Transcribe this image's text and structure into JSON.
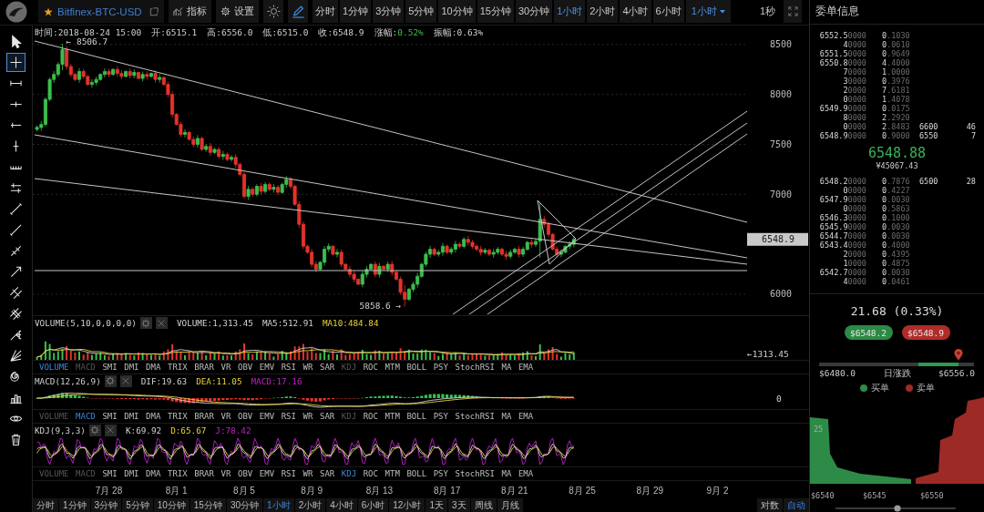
{
  "toolbar": {
    "symbol": "Bitfinex-BTC-USD",
    "buttons": [
      {
        "label": "指标",
        "kind": "indicators"
      },
      {
        "label": "设置",
        "kind": "settings"
      }
    ],
    "draw_mode": true,
    "periods": [
      {
        "label": "分时",
        "selected": false
      },
      {
        "label": "1分钟",
        "selected": false
      },
      {
        "label": "3分钟",
        "selected": false
      },
      {
        "label": "5分钟",
        "selected": false
      },
      {
        "label": "10分钟",
        "selected": false
      },
      {
        "label": "15分钟",
        "selected": false
      },
      {
        "label": "30分钟",
        "selected": false
      },
      {
        "label": "1小时",
        "selected": true
      },
      {
        "label": "2小时",
        "selected": false
      },
      {
        "label": "4小时",
        "selected": false
      },
      {
        "label": "6小时",
        "selected": false
      }
    ],
    "period_menu": {
      "label": "1小时",
      "selected": true
    },
    "refresh": "1秒"
  },
  "drawing_tools": [
    {
      "selected": false
    },
    {
      "selected": true
    },
    {
      "selected": false
    },
    {
      "selected": false
    },
    {
      "selected": false
    },
    {
      "selected": false
    },
    {
      "selected": false
    },
    {
      "selected": false
    },
    {
      "selected": false
    },
    {
      "selected": false
    },
    {
      "selected": false
    },
    {
      "selected": false
    },
    {
      "selected": false
    },
    {
      "selected": false
    },
    {
      "selected": false
    },
    {
      "selected": false
    },
    {
      "selected": false
    },
    {
      "selected": false
    },
    {
      "selected": false
    },
    {
      "selected": false
    }
  ],
  "price_chart": {
    "info": [
      {
        "label": "时间:",
        "value": "2018-08-24 15:00",
        "up": false
      },
      {
        "label": "开:",
        "value": "6515.1",
        "up": false
      },
      {
        "label": "高:",
        "value": "6556.0",
        "up": false
      },
      {
        "label": "低:",
        "value": "6515.0",
        "up": false
      },
      {
        "label": "收:",
        "value": "6548.9",
        "up": false
      },
      {
        "label": "涨幅:",
        "value": "0.52%",
        "up": true
      },
      {
        "label": "振幅:",
        "value": "0.63%",
        "up": false
      }
    ],
    "y_axis_labels": [
      "8500",
      "8000",
      "7500",
      "7000",
      "6000"
    ],
    "high_label": "← 8506.7",
    "low_label": "5858.6 →",
    "last_price": "6548.9"
  },
  "volume_panel": {
    "title": "VOLUME(5,10,0,0,0,0)",
    "readings": [
      {
        "text": "VOLUME:1,313.45",
        "color": "#d2d2d2"
      },
      {
        "text": "MA5:512.91",
        "color": "#d2d2d2"
      },
      {
        "text": "MA10:484.84",
        "color": "#e6d23c"
      }
    ],
    "last_label": "←1313.45",
    "tabs": [
      {
        "label": "VOLUME",
        "selected": true,
        "disabled": false
      },
      {
        "label": "MACD",
        "selected": false,
        "disabled": true
      },
      {
        "label": "SMI",
        "selected": false,
        "disabled": false
      },
      {
        "label": "DMI",
        "selected": false,
        "disabled": false
      },
      {
        "label": "DMA",
        "selected": false,
        "disabled": false
      },
      {
        "label": "TRIX",
        "selected": false,
        "disabled": false
      },
      {
        "label": "BRAR",
        "selected": false,
        "disabled": false
      },
      {
        "label": "VR",
        "selected": false,
        "disabled": false
      },
      {
        "label": "OBV",
        "selected": false,
        "disabled": false
      },
      {
        "label": "EMV",
        "selected": false,
        "disabled": false
      },
      {
        "label": "RSI",
        "selected": false,
        "disabled": false
      },
      {
        "label": "WR",
        "selected": false,
        "disabled": false
      },
      {
        "label": "SAR",
        "selected": false,
        "disabled": false
      },
      {
        "label": "KDJ",
        "selected": false,
        "disabled": true
      },
      {
        "label": "ROC",
        "selected": false,
        "disabled": false
      },
      {
        "label": "MTM",
        "selected": false,
        "disabled": false
      },
      {
        "label": "BOLL",
        "selected": false,
        "disabled": false
      },
      {
        "label": "PSY",
        "selected": false,
        "disabled": false
      },
      {
        "label": "StochRSI",
        "selected": false,
        "disabled": false
      },
      {
        "label": "MA",
        "selected": false,
        "disabled": false
      },
      {
        "label": "EMA",
        "selected": false,
        "disabled": false
      }
    ]
  },
  "macd_panel": {
    "title": "MACD(12,26,9)",
    "readings": [
      {
        "text": "DIF:19.63",
        "color": "#d2d2d2"
      },
      {
        "text": "DEA:11.05",
        "color": "#e6d23c"
      },
      {
        "text": "MACD:17.16",
        "color": "#c020c8"
      }
    ],
    "zero_label": "0",
    "tabs": [
      {
        "label": "VOLUME",
        "selected": false,
        "disabled": true
      },
      {
        "label": "MACD",
        "selected": true,
        "disabled": false
      },
      {
        "label": "SMI",
        "selected": false,
        "disabled": false
      },
      {
        "label": "DMI",
        "selected": false,
        "disabled": false
      },
      {
        "label": "DMA",
        "selected": false,
        "disabled": false
      },
      {
        "label": "TRIX",
        "selected": false,
        "disabled": false
      },
      {
        "label": "BRAR",
        "selected": false,
        "disabled": false
      },
      {
        "label": "VR",
        "selected": false,
        "disabled": false
      },
      {
        "label": "OBV",
        "selected": false,
        "disabled": false
      },
      {
        "label": "EMV",
        "selected": false,
        "disabled": false
      },
      {
        "label": "RSI",
        "selected": false,
        "disabled": false
      },
      {
        "label": "WR",
        "selected": false,
        "disabled": false
      },
      {
        "label": "SAR",
        "selected": false,
        "disabled": false
      },
      {
        "label": "KDJ",
        "selected": false,
        "disabled": true
      },
      {
        "label": "ROC",
        "selected": false,
        "disabled": false
      },
      {
        "label": "MTM",
        "selected": false,
        "disabled": false
      },
      {
        "label": "BOLL",
        "selected": false,
        "disabled": false
      },
      {
        "label": "PSY",
        "selected": false,
        "disabled": false
      },
      {
        "label": "StochRSI",
        "selected": false,
        "disabled": false
      },
      {
        "label": "MA",
        "selected": false,
        "disabled": false
      },
      {
        "label": "EMA",
        "selected": false,
        "disabled": false
      }
    ]
  },
  "kdj_panel": {
    "title": "KDJ(9,3,3)",
    "readings": [
      {
        "text": "K:69.92",
        "color": "#d2d2d2"
      },
      {
        "text": "D:65.67",
        "color": "#e6d23c"
      },
      {
        "text": "J:78.42",
        "color": "#c020c8"
      }
    ],
    "tabs": [
      {
        "label": "VOLUME",
        "selected": false,
        "disabled": true
      },
      {
        "label": "MACD",
        "selected": false,
        "disabled": true
      },
      {
        "label": "SMI",
        "selected": false,
        "disabled": false
      },
      {
        "label": "DMI",
        "selected": false,
        "disabled": false
      },
      {
        "label": "DMA",
        "selected": false,
        "disabled": false
      },
      {
        "label": "TRIX",
        "selected": false,
        "disabled": false
      },
      {
        "label": "BRAR",
        "selected": false,
        "disabled": false
      },
      {
        "label": "VR",
        "selected": false,
        "disabled": false
      },
      {
        "label": "OBV",
        "selected": false,
        "disabled": false
      },
      {
        "label": "EMV",
        "selected": false,
        "disabled": false
      },
      {
        "label": "RSI",
        "selected": false,
        "disabled": false
      },
      {
        "label": "WR",
        "selected": false,
        "disabled": false
      },
      {
        "label": "SAR",
        "selected": false,
        "disabled": false
      },
      {
        "label": "KDJ",
        "selected": true,
        "disabled": false
      },
      {
        "label": "ROC",
        "selected": false,
        "disabled": false
      },
      {
        "label": "MTM",
        "selected": false,
        "disabled": false
      },
      {
        "label": "BOLL",
        "selected": false,
        "disabled": false
      },
      {
        "label": "PSY",
        "selected": false,
        "disabled": false
      },
      {
        "label": "StochRSI",
        "selected": false,
        "disabled": false
      },
      {
        "label": "MA",
        "selected": false,
        "disabled": false
      },
      {
        "label": "EMA",
        "selected": false,
        "disabled": false
      }
    ]
  },
  "date_axis": [
    "7月 28",
    "8月 1",
    "8月 5",
    "8月 9",
    "8月 13",
    "8月 17",
    "8月 21",
    "8月 25",
    "8月 29",
    "9月 2"
  ],
  "bottom_bar": {
    "periods": [
      {
        "label": "分时",
        "selected": false
      },
      {
        "label": "1分钟",
        "selected": false
      },
      {
        "label": "3分钟",
        "selected": false
      },
      {
        "label": "5分钟",
        "selected": false
      },
      {
        "label": "10分钟",
        "selected": false
      },
      {
        "label": "15分钟",
        "selected": false
      },
      {
        "label": "30分钟",
        "selected": false
      },
      {
        "label": "1小时",
        "selected": true
      },
      {
        "label": "2小时",
        "selected": false
      },
      {
        "label": "4小时",
        "selected": false
      },
      {
        "label": "6小时",
        "selected": false
      },
      {
        "label": "12小时",
        "selected": false
      },
      {
        "label": "1天",
        "selected": false
      },
      {
        "label": "3天",
        "selected": false
      },
      {
        "label": "周线",
        "selected": false
      },
      {
        "label": "月线",
        "selected": false
      }
    ],
    "scale_modes": [
      {
        "label": "对数",
        "selected": false
      },
      {
        "label": "自动",
        "selected": true
      }
    ]
  },
  "order_panel": {
    "title": "委单信息",
    "asks": [
      {
        "price": "6552.5",
        "price_tail": "0000",
        "amount": "0",
        "amount_tail": ".1030"
      },
      {
        "price": "4",
        "price_tail": "0000",
        "amount": "0",
        "amount_tail": ".0610"
      },
      {
        "price": "6551.5",
        "price_tail": "0000",
        "amount": "0",
        "amount_tail": ".9649"
      },
      {
        "price": "6550.8",
        "price_tail": "0000",
        "amount": "4",
        "amount_tail": ".4000"
      },
      {
        "price": "7",
        "price_tail": "0000",
        "amount": "1",
        "amount_tail": ".0000"
      },
      {
        "price": "3",
        "price_tail": "0000",
        "amount": "0",
        "amount_tail": ".3976"
      },
      {
        "price": "2",
        "price_tail": "0000",
        "amount": "7",
        "amount_tail": ".6181"
      },
      {
        "price": "0",
        "price_tail": "0000",
        "amount": "1",
        "amount_tail": ".4078"
      },
      {
        "price": "6549.9",
        "price_tail": "0000",
        "amount": "0",
        "amount_tail": ".0175"
      },
      {
        "price": "8",
        "price_tail": "0000",
        "amount": "2",
        "amount_tail": ".2920"
      },
      {
        "price": "0",
        "price_tail": "0000",
        "amount": "2",
        "amount_tail": ".8483",
        "group_price": "6600",
        "group_count": "46"
      },
      {
        "price": "6548.9",
        "price_tail": "0000",
        "amount": "0",
        "amount_tail": ".9000",
        "group_price": "6550",
        "group_count": "7"
      }
    ],
    "mid_price": "6548.88",
    "mid_cny": "¥45067.43",
    "bids": [
      {
        "price": "6548.2",
        "price_tail": "0000",
        "amount": "0",
        "amount_tail": ".7876",
        "group_price": "6500",
        "group_count": "28"
      },
      {
        "price": "0",
        "price_tail": "0000",
        "amount": "0",
        "amount_tail": ".4227"
      },
      {
        "price": "6547.9",
        "price_tail": "0000",
        "amount": "0",
        "amount_tail": ".0030"
      },
      {
        "price": "0",
        "price_tail": "0000",
        "amount": "0",
        "amount_tail": ".5863"
      },
      {
        "price": "6546.3",
        "price_tail": "0000",
        "amount": "0",
        "amount_tail": ".1000"
      },
      {
        "price": "6545.9",
        "price_tail": "0000",
        "amount": "0",
        "amount_tail": ".0030"
      },
      {
        "price": "6544.7",
        "price_tail": "0000",
        "amount": "0",
        "amount_tail": ".0030"
      },
      {
        "price": "6543.4",
        "price_tail": "0000",
        "amount": "0",
        "amount_tail": ".4000"
      },
      {
        "price": "2",
        "price_tail": "0000",
        "amount": "0",
        "amount_tail": ".4395"
      },
      {
        "price": "1",
        "price_tail": "0000",
        "amount": "0",
        "amount_tail": ".4875"
      },
      {
        "price": "6542.7",
        "price_tail": "0000",
        "amount": "0",
        "amount_tail": ".0030"
      },
      {
        "price": "4",
        "price_tail": "0000",
        "amount": "0",
        "amount_tail": ".0461"
      }
    ],
    "change": "21.68 (0.33%)",
    "trade_buttons": [
      {
        "label": "$6548.2",
        "kind": "buy"
      },
      {
        "label": "$6548.9",
        "kind": "sell"
      }
    ],
    "range": {
      "low": "$6480.0",
      "label": "日涨跌",
      "high": "$6556.0",
      "level": 0.9
    },
    "legend": [
      {
        "label": "买单",
        "color": "#2e8b47"
      },
      {
        "label": "卖单",
        "color": "#9c2a26"
      }
    ],
    "depth": {
      "y_label": "25",
      "x_labels": [
        "$6540",
        "$6545",
        "$6550"
      ]
    }
  }
}
